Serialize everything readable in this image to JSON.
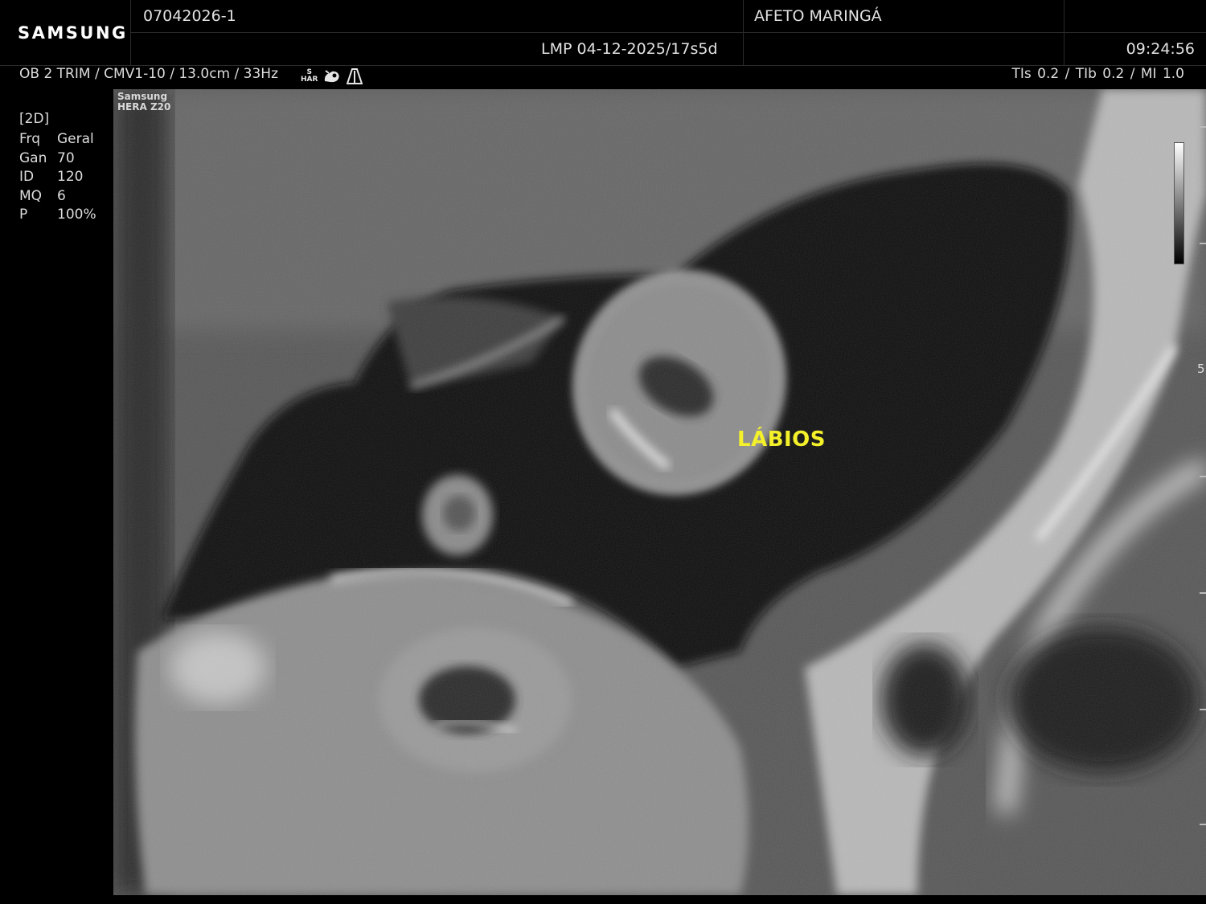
{
  "header": {
    "brand": "SAMSUNG",
    "patient_id": "07042026-1",
    "institution": "AFETO MARINGÁ",
    "lmp": "LMP 04-12-2025/17s5d",
    "time": "09:24:56"
  },
  "infobar": {
    "preset": "OB 2 TRIM / CMV1-10 / 13.0cm / 33Hz",
    "har_icon_top": "S",
    "har_icon_bottom": "HAR",
    "indices": "TIs  0.2 / TIb  0.2 / MI   1.0"
  },
  "params": {
    "mode": "[2D]",
    "rows": [
      {
        "key": "Frq",
        "value": "Geral"
      },
      {
        "key": "Gan",
        "value": "70"
      },
      {
        "key": "ID",
        "value": "120"
      },
      {
        "key": "MQ",
        "value": "6"
      },
      {
        "key": "P",
        "value": "100%"
      }
    ]
  },
  "image": {
    "device_line1": "Samsung",
    "device_line2": "HERA Z20",
    "annotation": "LÁBIOS",
    "annotation_color": "#f4f12a"
  },
  "scale": {
    "depth_marker": "5"
  },
  "icons": [
    "har-icon",
    "fetus-icon",
    "probe-icon"
  ]
}
